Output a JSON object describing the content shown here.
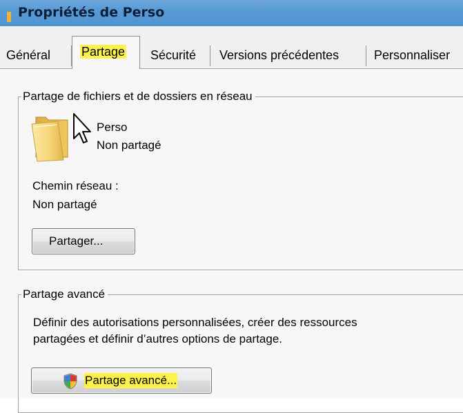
{
  "window": {
    "title": "Propriétés de Perso"
  },
  "tabs": [
    {
      "label": "Général"
    },
    {
      "label": "Partage",
      "selected": true
    },
    {
      "label": "Sécurité"
    },
    {
      "label": "Versions précédentes"
    },
    {
      "label": "Personnaliser"
    }
  ],
  "network_share": {
    "legend": "Partage de fichiers et de dossiers en réseau",
    "folder_name": "Perso",
    "folder_status": "Non partagé",
    "network_path_label": "Chemin réseau :",
    "network_path_value": "Non partagé",
    "share_button": "Partager..."
  },
  "advanced_share": {
    "legend": "Partage avancé",
    "description_line1": "Définir des autorisations personnalisées, créer des ressources",
    "description_line2": "partagées et définir d’autres options de partage.",
    "button": "Partage avancé..."
  },
  "icons": {
    "title": "folder-title-icon",
    "folder": "folder-icon",
    "cursor": "mouse-pointer-icon",
    "uac": "uac-shield-icon"
  },
  "colors": {
    "titlebar": "#5a9bd5",
    "highlight": "#fff24b",
    "dialog_bg": "#f0f0f0",
    "panel_bg": "#f7f7f7",
    "folder_yellow": "#f5d576"
  }
}
